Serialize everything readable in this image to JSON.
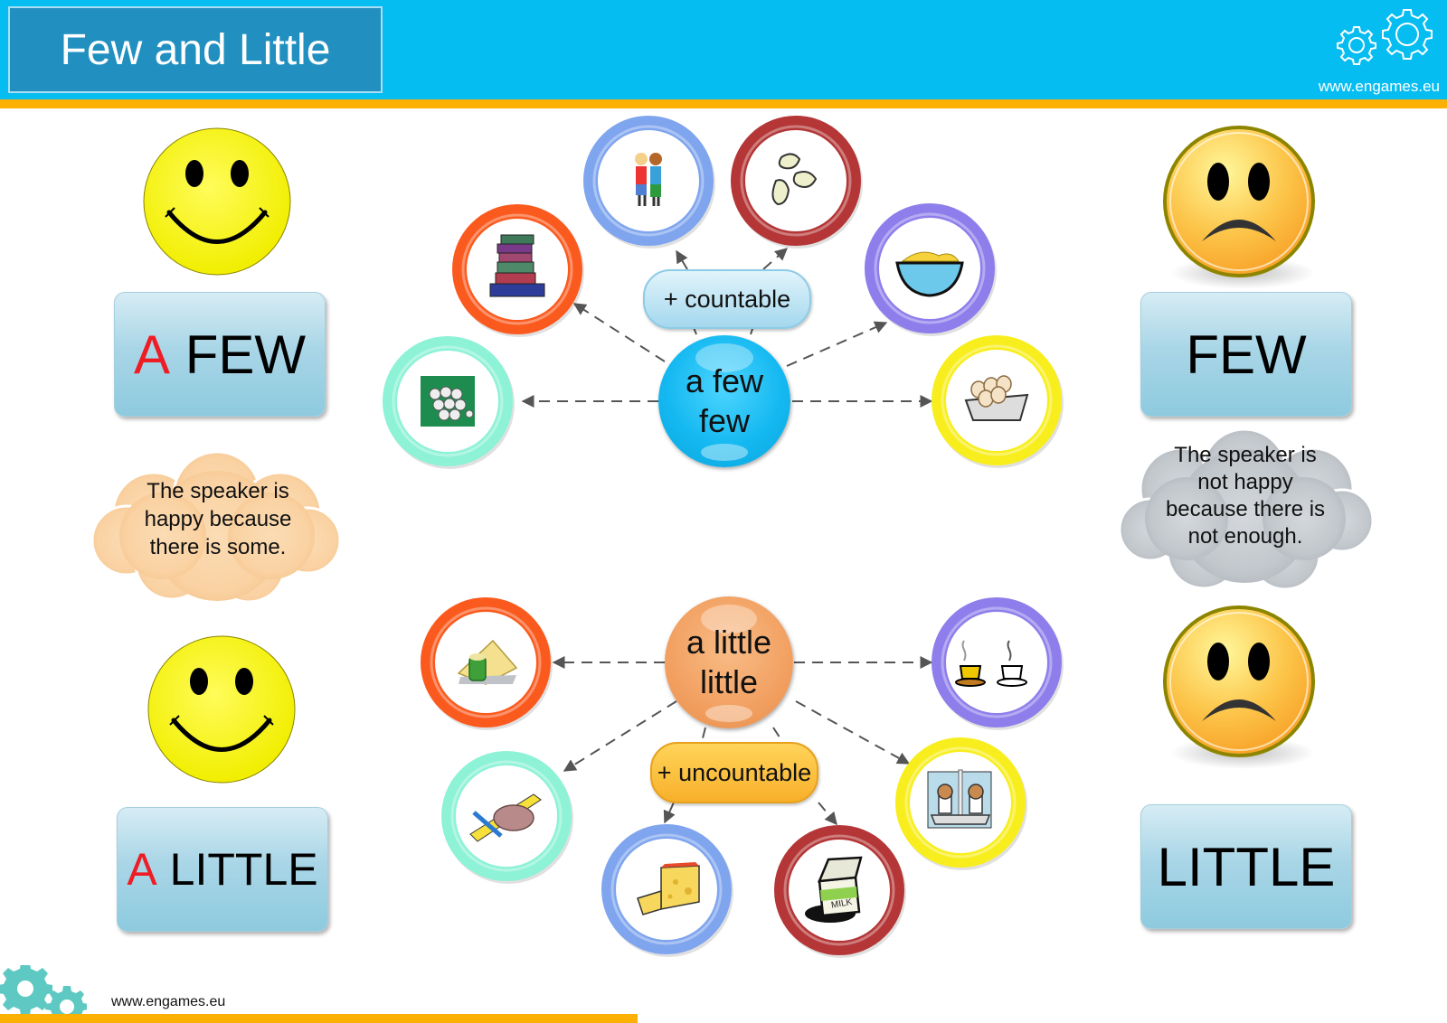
{
  "header": {
    "title": "Few and Little",
    "url": "www.engames.eu",
    "icon": "gears-icon"
  },
  "footer": {
    "url": "www.engames.eu",
    "icon": "gears-icon"
  },
  "colors": {
    "header_bg": "#06bdf2",
    "title_bg": "#2190c0",
    "stripe": "#fbb003",
    "accent_red": "#ee1c24",
    "label_box": "#a9d6e7"
  },
  "left_column": {
    "a_few": {
      "face": "happy-face-icon",
      "accent": "A",
      "word": "FEW"
    },
    "cloud_text": [
      "The speaker is",
      "happy because",
      "there is some."
    ],
    "a_little": {
      "face": "happy-face-icon",
      "accent": "A",
      "word": "LITTLE"
    }
  },
  "right_column": {
    "few": {
      "face": "sad-face-icon",
      "word": "FEW"
    },
    "cloud_text": [
      "The speaker is",
      "not happy",
      "because there is",
      "not enough."
    ],
    "little": {
      "face": "sad-face-icon",
      "word": "LITTLE"
    }
  },
  "few_diagram": {
    "hub_lines": [
      "a few",
      "few"
    ],
    "category": "+ countable",
    "items": [
      {
        "name": "golf-balls",
        "icon": "golf-balls-icon",
        "ring": "#8df2d6"
      },
      {
        "name": "books",
        "icon": "books-icon",
        "ring": "#fb5a1e"
      },
      {
        "name": "children",
        "icon": "children-icon",
        "ring": "#7fa5ee"
      },
      {
        "name": "beans",
        "icon": "beans-icon",
        "ring": "#b43636"
      },
      {
        "name": "chips-bowl",
        "icon": "chips-bowl-icon",
        "ring": "#8e7eeb"
      },
      {
        "name": "eggs",
        "icon": "eggs-icon",
        "ring": "#f8ee1e"
      }
    ]
  },
  "little_diagram": {
    "hub_lines": [
      "a little",
      "little"
    ],
    "category": "+ uncountable",
    "items": [
      {
        "name": "butter",
        "icon": "butter-icon",
        "ring": "#fb5a1e"
      },
      {
        "name": "coffee",
        "icon": "coffee-cups-icon",
        "ring": "#8e7eeb"
      },
      {
        "name": "ham",
        "icon": "ham-icon",
        "ring": "#8df2d6"
      },
      {
        "name": "salt-pepper",
        "icon": "salt-pepper-icon",
        "ring": "#f8ee1e"
      },
      {
        "name": "cheese",
        "icon": "cheese-icon",
        "ring": "#7fa5ee"
      },
      {
        "name": "milk",
        "icon": "milk-carton-icon",
        "ring": "#b43636"
      }
    ],
    "milk_label": "MILK"
  }
}
